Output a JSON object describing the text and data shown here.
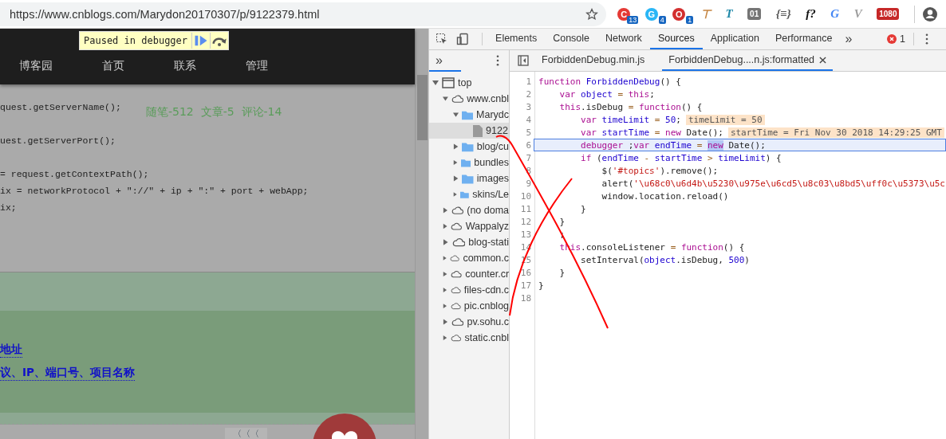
{
  "browser": {
    "url": "https://www.cnblogs.com/Marydon20170307/p/9122379.html",
    "extensions": [
      {
        "kind": "badge",
        "label": "C",
        "badge": "13",
        "color": "#e53935"
      },
      {
        "kind": "badge",
        "label": "G",
        "badge": "4",
        "color": "#29b6f6"
      },
      {
        "kind": "badge",
        "label": "O",
        "badge": "1",
        "color": "#d32f2f"
      },
      {
        "kind": "glyph",
        "label": "⊤",
        "color": "#c68642"
      },
      {
        "kind": "glyph",
        "label": "T",
        "color": "#1e88a8"
      },
      {
        "kind": "tile",
        "label": "01",
        "color": "#757575"
      },
      {
        "kind": "glyph",
        "label": "{≡}",
        "color": "#555555"
      },
      {
        "kind": "glyph",
        "label": "f?",
        "color": "#111111"
      },
      {
        "kind": "glyph",
        "label": "G",
        "color": "#4285f4"
      },
      {
        "kind": "glyph",
        "label": "V",
        "color": "#9e9e9e"
      },
      {
        "kind": "tile",
        "label": "1080",
        "color": "#c62828"
      }
    ]
  },
  "page": {
    "nav": [
      "博客园",
      "首页",
      "联系",
      "管理"
    ],
    "debugger_banner": {
      "text": "Paused in debugger"
    },
    "code_lines": [
      "quest.getServerName();",
      "uest.getServerPort();",
      "= request.getContextPath();",
      "ix = networkProtocol + \"://\" + ip + \":\" + port + webApp;",
      "ix;"
    ],
    "stats": "随笔-512  文章-5  评论-14",
    "links": [
      "地址",
      "议、IP、端口号、项目名称"
    ],
    "collapse": "〈〈〈"
  },
  "devtools": {
    "tabs": [
      {
        "label": "Elements",
        "selected": false
      },
      {
        "label": "Console",
        "selected": false
      },
      {
        "label": "Network",
        "selected": false
      },
      {
        "label": "Sources",
        "selected": true
      },
      {
        "label": "Application",
        "selected": false
      },
      {
        "label": "Performance",
        "selected": false
      }
    ],
    "more": "»",
    "errors": "1",
    "navigator_more": "»",
    "file_tabs": [
      {
        "label": "ForbiddenDebug.min.js",
        "selected": false
      },
      {
        "label": "ForbiddenDebug....n.js:formatted",
        "selected": true
      }
    ],
    "navigator": {
      "tree": [
        {
          "kind": "frame",
          "label": "top",
          "expanded": true,
          "selected": false,
          "children": [
            {
              "kind": "domain",
              "label": "www.cnbl",
              "expanded": true,
              "selected": false,
              "children": [
                {
                  "kind": "folder",
                  "label": "Marydc",
                  "expanded": true,
                  "selected": false,
                  "children": [
                    {
                      "kind": "file",
                      "label": "9122",
                      "selected": true
                    }
                  ]
                },
                {
                  "kind": "folder",
                  "label": "blog/cu",
                  "expanded": false,
                  "selected": false
                },
                {
                  "kind": "folder",
                  "label": "bundles",
                  "expanded": false,
                  "selected": false
                },
                {
                  "kind": "folder",
                  "label": "images",
                  "expanded": false,
                  "selected": false
                },
                {
                  "kind": "folder",
                  "label": "skins/Le",
                  "expanded": false,
                  "selected": false
                }
              ]
            },
            {
              "kind": "domain",
              "label": "(no doma",
              "expanded": false,
              "selected": false
            },
            {
              "kind": "domain",
              "label": "Wappalyz",
              "expanded": false,
              "selected": false
            },
            {
              "kind": "domain",
              "label": "blog-stati",
              "expanded": false,
              "selected": false
            },
            {
              "kind": "domain",
              "label": "common.c",
              "expanded": false,
              "selected": false
            },
            {
              "kind": "domain",
              "label": "counter.cr",
              "expanded": false,
              "selected": false
            },
            {
              "kind": "domain",
              "label": "files-cdn.c",
              "expanded": false,
              "selected": false
            },
            {
              "kind": "domain",
              "label": "pic.cnblog",
              "expanded": false,
              "selected": false
            },
            {
              "kind": "domain",
              "label": "pv.sohu.c",
              "expanded": false,
              "selected": false
            },
            {
              "kind": "domain",
              "label": "static.cnbl",
              "expanded": false,
              "selected": false
            }
          ]
        }
      ]
    },
    "editor": {
      "lines": [
        {
          "number": "1",
          "current": false,
          "tokens": [
            {
              "text": "function",
              "kind": "keyword"
            },
            {
              "text": " ForbiddenDebug",
              "kind": "name"
            },
            {
              "text": "() {",
              "kind": "plain"
            }
          ]
        },
        {
          "number": "2",
          "current": false,
          "tokens": [
            {
              "text": "    var",
              "kind": "keyword"
            },
            {
              "text": " object",
              "kind": "name"
            },
            {
              "text": " = ",
              "kind": "operator"
            },
            {
              "text": "this",
              "kind": "keyword"
            },
            {
              "text": ";",
              "kind": "plain"
            }
          ]
        },
        {
          "number": "3",
          "current": false,
          "tokens": [
            {
              "text": "    this",
              "kind": "keyword"
            },
            {
              "text": ".isDebug ",
              "kind": "plain"
            },
            {
              "text": "= ",
              "kind": "operator"
            },
            {
              "text": "function",
              "kind": "keyword"
            },
            {
              "text": "() {",
              "kind": "plain"
            }
          ]
        },
        {
          "number": "4",
          "current": false,
          "tokens": [
            {
              "text": "        var",
              "kind": "keyword"
            },
            {
              "text": " timeLimit",
              "kind": "name"
            },
            {
              "text": " = ",
              "kind": "operator"
            },
            {
              "text": "50",
              "kind": "number"
            },
            {
              "text": ";",
              "kind": "plain"
            }
          ],
          "inline_value": "timeLimit = 50"
        },
        {
          "number": "5",
          "current": false,
          "tokens": [
            {
              "text": "        var",
              "kind": "keyword"
            },
            {
              "text": " startTime",
              "kind": "name"
            },
            {
              "text": " = ",
              "kind": "operator"
            },
            {
              "text": "new",
              "kind": "keyword"
            },
            {
              "text": " Date();",
              "kind": "plain"
            }
          ],
          "inline_value": "startTime = Fri Nov 30 2018 14:29:25 GMT"
        },
        {
          "number": "6",
          "current": true,
          "tokens": [
            {
              "text": "        debugger",
              "kind": "keyword"
            },
            {
              "text": " ;",
              "kind": "plain"
            },
            {
              "text": "var",
              "kind": "keyword"
            },
            {
              "text": " endTime",
              "kind": "name"
            },
            {
              "text": " = ",
              "kind": "operator"
            },
            {
              "text": "new",
              "kind": "match"
            },
            {
              "text": " Date();",
              "kind": "plain"
            }
          ]
        },
        {
          "number": "7",
          "current": false,
          "tokens": [
            {
              "text": "        if",
              "kind": "keyword"
            },
            {
              "text": " (",
              "kind": "plain"
            },
            {
              "text": "endTime",
              "kind": "name"
            },
            {
              "text": " - ",
              "kind": "operator"
            },
            {
              "text": "startTime",
              "kind": "name"
            },
            {
              "text": " > ",
              "kind": "operator"
            },
            {
              "text": "timeLimit",
              "kind": "name"
            },
            {
              "text": ") {",
              "kind": "plain"
            }
          ]
        },
        {
          "number": "8",
          "current": false,
          "tokens": [
            {
              "text": "            $(",
              "kind": "plain"
            },
            {
              "text": "'#topics'",
              "kind": "string"
            },
            {
              "text": ").remove();",
              "kind": "plain"
            }
          ]
        },
        {
          "number": "9",
          "current": false,
          "tokens": [
            {
              "text": "            alert(",
              "kind": "plain"
            },
            {
              "text": "'\\u68c0\\u6d4b\\u5230\\u975e\\u6cd5\\u8c03\\u8bd5\\uff0c\\u5373\\u5c",
              "kind": "string"
            }
          ]
        },
        {
          "number": "10",
          "current": false,
          "tokens": [
            {
              "text": "            window.location.reload()",
              "kind": "plain"
            }
          ]
        },
        {
          "number": "11",
          "current": false,
          "tokens": [
            {
              "text": "        }",
              "kind": "plain"
            }
          ]
        },
        {
          "number": "12",
          "current": false,
          "tokens": [
            {
              "text": "    }",
              "kind": "plain"
            }
          ]
        },
        {
          "number": "13",
          "current": false,
          "tokens": [
            {
              "text": "    ;",
              "kind": "plain"
            }
          ]
        },
        {
          "number": "14",
          "current": false,
          "tokens": [
            {
              "text": "    this",
              "kind": "keyword"
            },
            {
              "text": ".consoleListener ",
              "kind": "plain"
            },
            {
              "text": "= ",
              "kind": "operator"
            },
            {
              "text": "function",
              "kind": "keyword"
            },
            {
              "text": "() {",
              "kind": "plain"
            }
          ]
        },
        {
          "number": "15",
          "current": false,
          "tokens": [
            {
              "text": "        setInterval(",
              "kind": "plain"
            },
            {
              "text": "object",
              "kind": "name"
            },
            {
              "text": ".isDebug, ",
              "kind": "plain"
            },
            {
              "text": "500",
              "kind": "number"
            },
            {
              "text": ")",
              "kind": "plain"
            }
          ]
        },
        {
          "number": "16",
          "current": false,
          "tokens": [
            {
              "text": "    }",
              "kind": "plain"
            }
          ]
        },
        {
          "number": "17",
          "current": false,
          "tokens": [
            {
              "text": "}",
              "kind": "plain"
            }
          ]
        },
        {
          "number": "18",
          "current": false
        }
      ]
    }
  }
}
